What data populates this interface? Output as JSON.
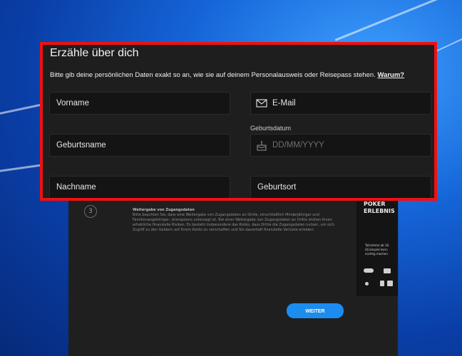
{
  "form": {
    "title": "Erzähle über dich",
    "subtitle": "Bitte gib deine persönlichen Daten exakt so an, wie sie auf deinem Personalausweis oder Reisepass stehen.",
    "why_link": "Warum?",
    "fields": {
      "vorname": "Vorname",
      "email": "E-Mail",
      "geburtsname": "Geburtsname",
      "geburtsdatum_label": "Geburtsdatum",
      "geburtsdatum_placeholder": "DD/MM/YYYY",
      "nachname": "Nachname",
      "geburtsort": "Geburtsort"
    }
  },
  "background": {
    "step_number": "3",
    "notice_title": "Weitergabe von Zugangsdaten",
    "notice_text": "Bitte beachten Sie, dass eine Weitergabe von Zugangsdaten an Dritte, einschließlich Minderjähriger und Familienangehöriger, strengstens untersagt ist. Bei einer Weitergabe von Zugangsdaten an Dritte drohen Ihnen erhebliche finanzielle Risiken. Es besteht insbesondere das Risiko, dass Dritte die Zugangsdaten nutzen, um sich Zugriff zu den Geldern auf Ihrem Konto zu verschaffen und Sie dauerhaft finanzielle Verluste erleiden.",
    "promo_title": "POKER\nERLEBNIS",
    "promo_desc": "Teilnehme ab 18. Glückspiel kann süchtig machen",
    "button_label": "WEITER"
  },
  "colors": {
    "highlight_border": "#ee1111",
    "panel_bg": "#1e1e1e",
    "field_bg": "#141414",
    "button_blue": "#1c8cf0"
  }
}
